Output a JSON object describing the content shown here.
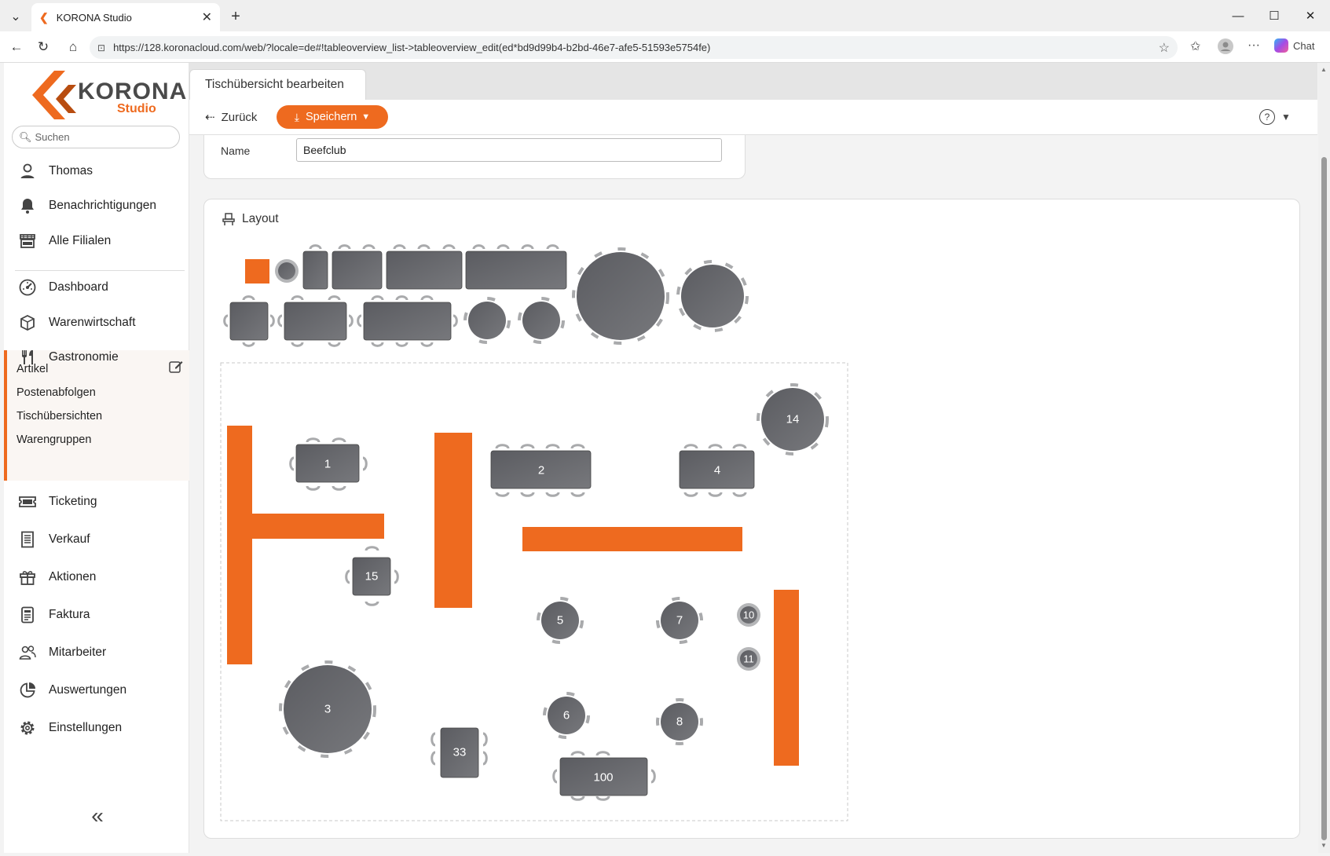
{
  "browser": {
    "tab_title": "KORONA Studio",
    "url": "https://128.koronacloud.com/web/?locale=de#!tableoverview_list->tableoverview_edit(ed*bd9d99b4-b2bd-46e7-afe5-51593e5754fe)",
    "chat_label": "Chat"
  },
  "logo": {
    "brand": "KORONA",
    "product": "Studio"
  },
  "search": {
    "placeholder": "Suchen"
  },
  "sidebar": {
    "user": "Thomas",
    "notifications": "Benachrichtigungen",
    "all_branches": "Alle Filialen",
    "items": [
      {
        "label": "Dashboard",
        "icon": "dashboard-icon"
      },
      {
        "label": "Warenwirtschaft",
        "icon": "box-icon"
      },
      {
        "label": "Gastronomie",
        "icon": "fork-knife-icon"
      },
      {
        "label": "Ticketing",
        "icon": "ticket-icon"
      },
      {
        "label": "Verkauf",
        "icon": "receipt-icon"
      },
      {
        "label": "Aktionen",
        "icon": "gift-icon"
      },
      {
        "label": "Faktura",
        "icon": "invoice-icon"
      },
      {
        "label": "Mitarbeiter",
        "icon": "people-icon"
      },
      {
        "label": "Auswertungen",
        "icon": "pie-chart-icon"
      },
      {
        "label": "Einstellungen",
        "icon": "gear-icon"
      }
    ],
    "gastro_sub": [
      "Artikel",
      "Postenabfolgen",
      "Tischübersichten",
      "Warengruppen"
    ]
  },
  "page": {
    "tab_title": "Tischübersicht bearbeiten",
    "back_label": "Zurück",
    "save_label": "Speichern",
    "name_label": "Name",
    "name_value": "Beefclub",
    "layout_title": "Layout"
  },
  "tables": {
    "t1": "1",
    "t2": "2",
    "t3": "3",
    "t4": "4",
    "t5": "5",
    "t6": "6",
    "t7": "7",
    "t8": "8",
    "t10": "10",
    "t11": "11",
    "t14": "14",
    "t15": "15",
    "t33": "33",
    "t100": "100"
  },
  "colors": {
    "accent": "#ee6a1f",
    "table": "#5f6064",
    "chair": "#a9aaac"
  }
}
